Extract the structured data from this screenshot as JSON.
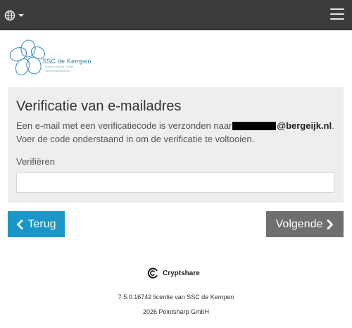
{
  "header": {
    "language_icon": "globe-icon",
    "language_caret_icon": "caret-down-icon",
    "menu_icon": "hamburger-menu-icon"
  },
  "logo": {
    "name": "SSC de Kempen",
    "tagline_1": "Shared Service Center",
    "tagline_2": "Kempengemeenten"
  },
  "verification": {
    "title": "Verificatie van e-mailadres",
    "line1_prefix": "Een e-mail met een verificatiecode is verzonden naar",
    "line1_email_domain": "@bergeijk.nl",
    "line1_suffix": ".",
    "line2": "Voer de code onderstaand in om de verificatie te voltooien.",
    "field_label": "Verifiëren",
    "field_value": ""
  },
  "actions": {
    "back_label": "Terug",
    "back_icon": "chevron-left-icon",
    "next_label": "Volgende",
    "next_icon": "chevron-right-icon"
  },
  "footer": {
    "brand_icon": "cryptshare-logo-icon",
    "brand_name": "Cryptshare",
    "version": "7.5.0.16742 licentie van SSC de Kempen",
    "copyright": "2026 Pointsharp GmbH"
  },
  "colors": {
    "topbar": "#3c3c3c",
    "panel": "#eeeeee",
    "back_button": "#1a96c8",
    "next_button": "#6f6f6f",
    "logo_blue": "#3a7fa0"
  }
}
